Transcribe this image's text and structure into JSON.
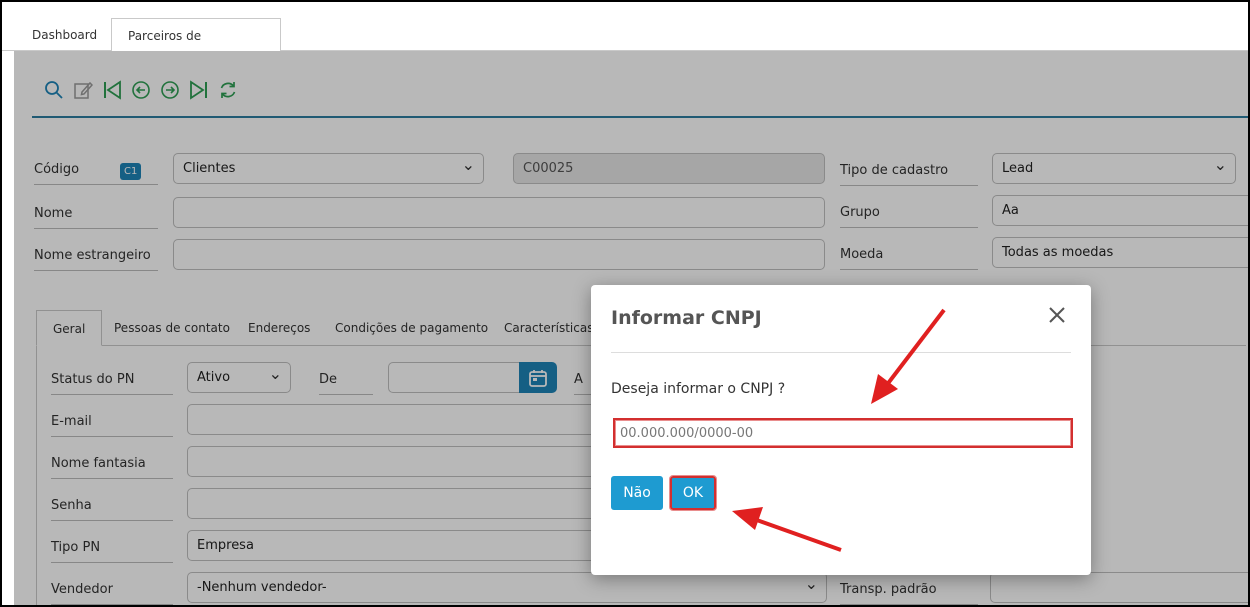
{
  "tabs": [
    {
      "label": "Dashboard"
    },
    {
      "label": "Parceiros de negócios"
    }
  ],
  "colors": {
    "accent": "#1e84b8",
    "icon_green": "#2e9e54",
    "highlight": "#d32f2f"
  },
  "form": {
    "codigo": {
      "label": "Código",
      "badge": "C1",
      "series": "Clientes",
      "value": "C00025"
    },
    "nome": {
      "label": "Nome",
      "value": ""
    },
    "nome_estrangeiro": {
      "label": "Nome estrangeiro",
      "value": ""
    },
    "tipo_cadastro": {
      "label": "Tipo de cadastro",
      "value": "Lead"
    },
    "grupo": {
      "label": "Grupo",
      "value": "Aa"
    },
    "moeda": {
      "label": "Moeda",
      "value": "Todas as moedas"
    }
  },
  "subtabs": [
    {
      "label": "Geral"
    },
    {
      "label": "Pessoas de contato"
    },
    {
      "label": "Endereços"
    },
    {
      "label": "Condições de pagamento"
    },
    {
      "label": "Características ad"
    }
  ],
  "geral": {
    "status": {
      "label": "Status do PN",
      "value": "Ativo"
    },
    "de": {
      "label": "De",
      "value": ""
    },
    "partial": "A",
    "email": {
      "label": "E-mail",
      "value": ""
    },
    "nome_fantasia": {
      "label": "Nome fantasia",
      "value": ""
    },
    "senha": {
      "label": "Senha",
      "value": ""
    },
    "tipo_pn": {
      "label": "Tipo PN",
      "value": "Empresa"
    },
    "vendedor": {
      "label": "Vendedor",
      "value": "-Nenhum vendedor-"
    },
    "transp": {
      "label": "Transp. padrão"
    }
  },
  "modal": {
    "title": "Informar CNPJ",
    "question": "Deseja informar o CNPJ ?",
    "input_placeholder": "00.000.000/0000-00",
    "no_label": "Não",
    "ok_label": "OK"
  }
}
